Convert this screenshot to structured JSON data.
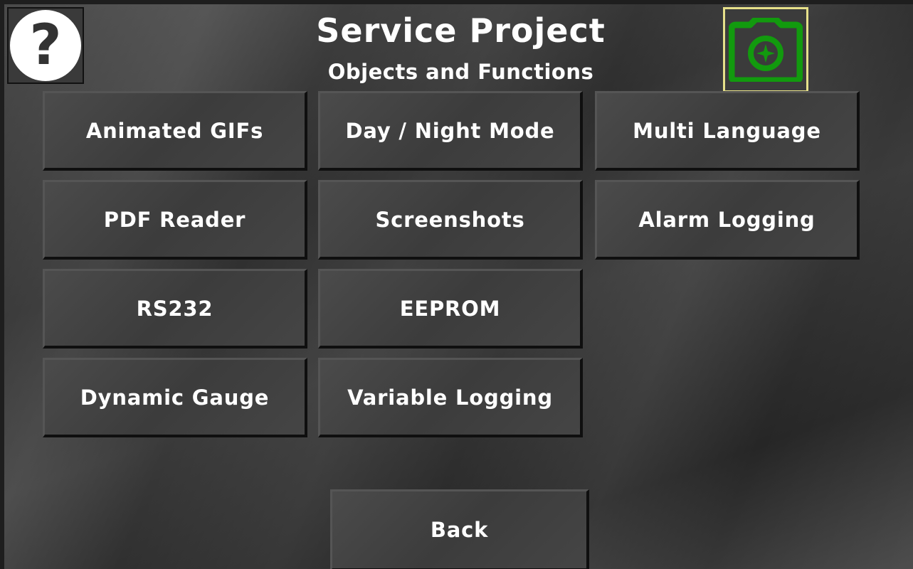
{
  "header": {
    "title": "Service Project",
    "subtitle": "Objects and Functions",
    "help_symbol": "?",
    "help_icon": "question-mark-icon",
    "camera_icon": "camera-icon",
    "camera_color": "#129a0e",
    "camera_focus_border": "#e6e08a"
  },
  "menu": {
    "items": [
      "Animated GIFs",
      "Day / Night Mode",
      "Multi Language",
      "PDF Reader",
      "Screenshots",
      "Alarm Logging",
      "RS232",
      "EEPROM",
      "Dynamic Gauge",
      "Variable Logging"
    ]
  },
  "footer": {
    "back_label": "Back"
  }
}
